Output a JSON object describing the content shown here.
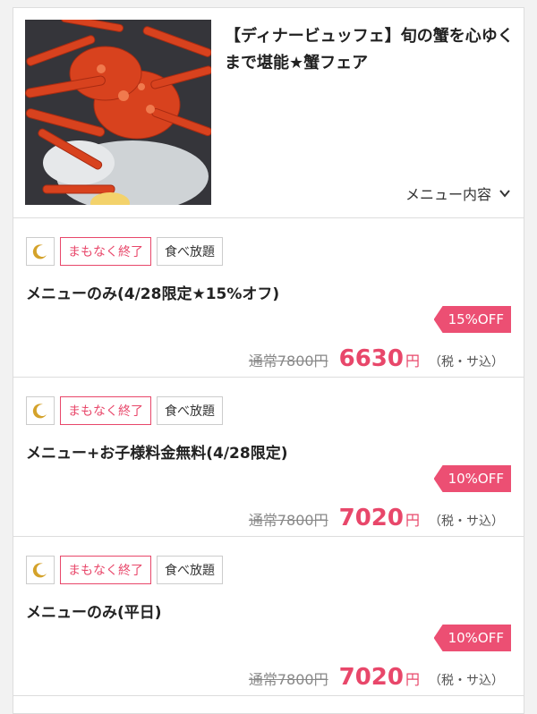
{
  "header": {
    "title": "【ディナービュッフェ】旬の蟹を心ゆくまで堪能★蟹フェア",
    "menu_toggle_label": "メニュー内容",
    "image_icon": "crab-photo"
  },
  "tag_labels": {
    "ending": "まもなく終了",
    "category": "食べ放題",
    "moon_icon": "moon-icon"
  },
  "plans": [
    {
      "name": "メニューのみ(4/28限定★15%オフ)",
      "discount": "15%OFF",
      "original_price": "通常7800円",
      "price": "6630",
      "yen": "円",
      "tax": "（税・サ込）"
    },
    {
      "name": "メニュー+お子様料金無料(4/28限定)",
      "discount": "10%OFF",
      "original_price": "通常7800円",
      "price": "7020",
      "yen": "円",
      "tax": "（税・サ込）"
    },
    {
      "name": "メニューのみ(平日)",
      "discount": "10%OFF",
      "original_price": "通常7800円",
      "price": "7020",
      "yen": "円",
      "tax": "（税・サ込）"
    }
  ],
  "colors": {
    "accent": "#e8476a",
    "badge": "#ec4f73",
    "moon": "#d4a22a"
  }
}
